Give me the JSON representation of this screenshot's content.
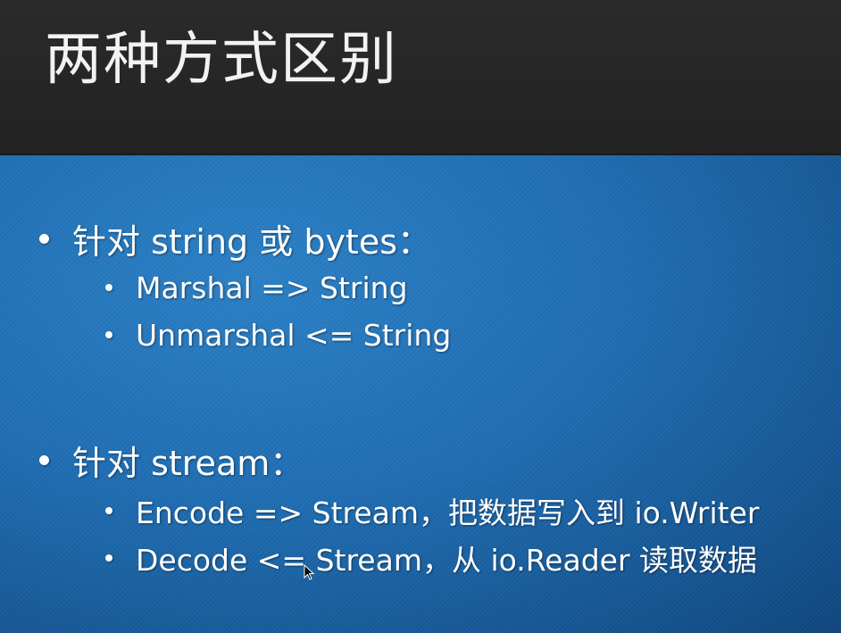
{
  "slide": {
    "title": "两种方式区别"
  },
  "bullets": [
    {
      "text": "针对 string 或 bytes：",
      "sub": [
        {
          "text": "Marshal => String"
        },
        {
          "text": "Unmarshal <= String"
        }
      ]
    },
    {
      "text": "针对 stream：",
      "sub": [
        {
          "text": "Encode => Stream，把数据写入到 io.Writer"
        },
        {
          "text": "Decode <= Stream，从 io.Reader 读取数据"
        }
      ]
    }
  ],
  "icons": {
    "bullet": "bullet-dot-icon",
    "cursor": "mouse-cursor-icon"
  },
  "colors": {
    "title_bar": "#262626",
    "content_bg": "#1f6db2",
    "text": "#ffffff"
  }
}
